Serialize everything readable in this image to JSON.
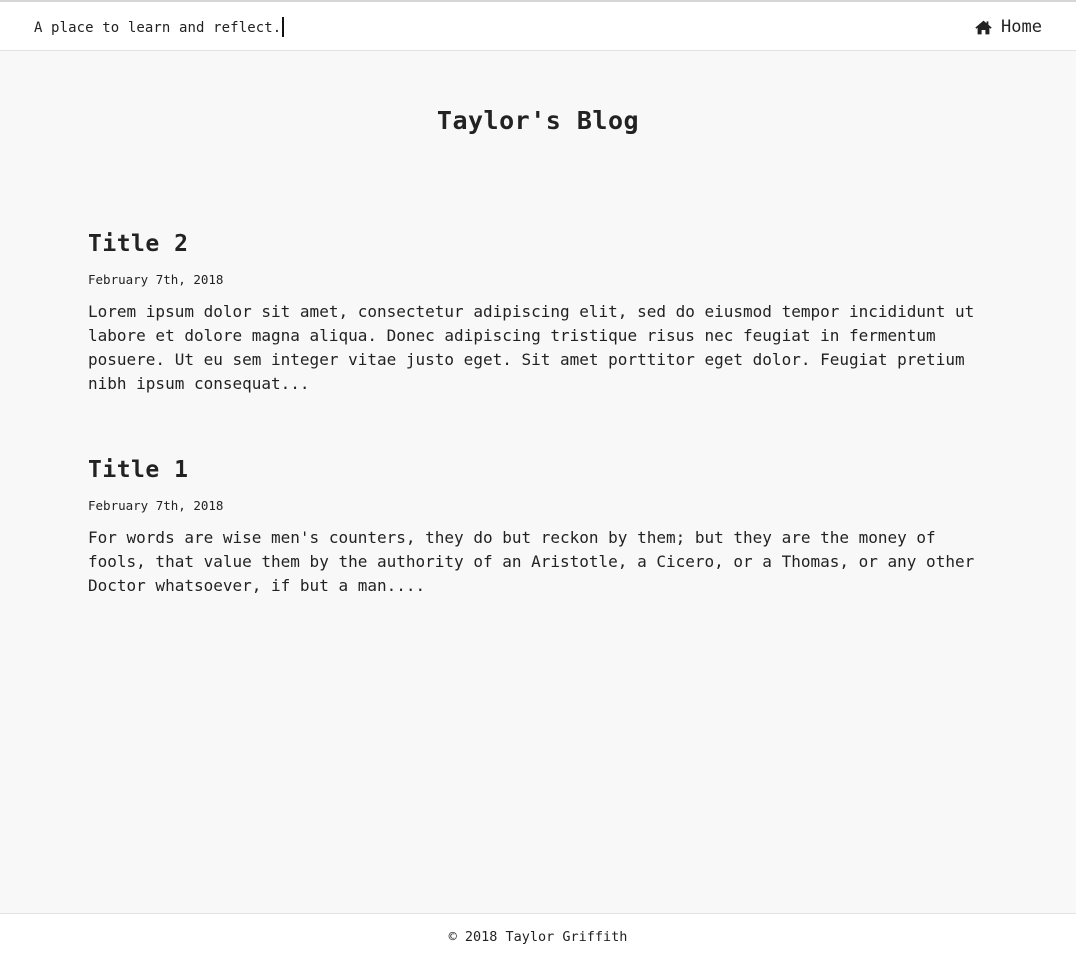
{
  "header": {
    "tagline": "A place to learn and reflect.",
    "nav": {
      "home_label": "Home",
      "home_icon": "home-icon"
    }
  },
  "main": {
    "title": "Taylor's Blog",
    "posts": [
      {
        "title": "Title 2",
        "date": "February 7th, 2018",
        "excerpt": "Lorem ipsum dolor sit amet, consectetur adipiscing elit, sed do eiusmod tempor incididunt ut labore et dolore magna aliqua. Donec adipiscing tristique risus nec feugiat in fermentum posuere. Ut eu sem integer vitae justo eget. Sit amet porttitor eget dolor. Feugiat pretium nibh ipsum consequat..."
      },
      {
        "title": "Title 1",
        "date": "February 7th, 2018",
        "excerpt": "For words are wise men's counters, they do but reckon by them; but they are the money of fools, that value them by the authority of an Aristotle, a Cicero, or a Thomas, or any other Doctor whatsoever, if but a man...."
      }
    ]
  },
  "footer": {
    "copyright": "© 2018 Taylor Griffith"
  },
  "colors": {
    "background": "#f8f8f8",
    "bar_background": "#ffffff",
    "text": "#222222"
  }
}
